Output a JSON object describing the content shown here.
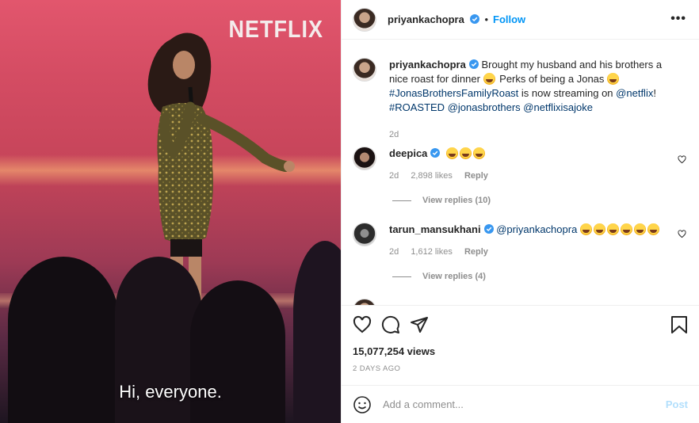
{
  "video": {
    "brand": "NETFLIX",
    "subtitle": "Hi, everyone."
  },
  "header": {
    "username": "priyankachopra",
    "follow_label": "Follow",
    "dot": "•",
    "more_label": "•••"
  },
  "caption": {
    "username": "priyankachopra",
    "text_before": "Brought my husband and his brothers a nice roast for dinner",
    "text_mid": "Perks of being a Jonas",
    "hashtag1": "#JonasBrothersFamilyRoast",
    "text_stream": "is now streaming on",
    "mention_netflix": "@netflix",
    "exclaim": "!",
    "hashtag2": "#ROASTED",
    "mention_jonas": "@jonasbrothers",
    "mention_joke": "@netflixisajoke",
    "time": "2d"
  },
  "comments": [
    {
      "username": "deepica",
      "text": "",
      "emoji_count": 3,
      "time": "2d",
      "likes": "2,898 likes",
      "reply_label": "Reply",
      "view_replies": "View replies (10)"
    },
    {
      "username": "tarun_mansukhani",
      "mention": "@priyankachopra",
      "emoji_count": 6,
      "time": "2d",
      "likes": "1,612 likes",
      "reply_label": "Reply",
      "view_replies": "View replies (4)"
    }
  ],
  "stats": {
    "views": "15,077,254 views",
    "date": "2 DAYS AGO"
  },
  "add_comment": {
    "placeholder": "Add a comment...",
    "post_label": "Post"
  },
  "colors": {
    "link": "#00376b",
    "follow": "#0095f6",
    "verified": "#3897f0",
    "muted": "#8e8e8e"
  },
  "icons": [
    "heart-icon",
    "comment-icon",
    "share-icon",
    "bookmark-icon",
    "emoji-icon",
    "more-icon",
    "verified-icon"
  ]
}
